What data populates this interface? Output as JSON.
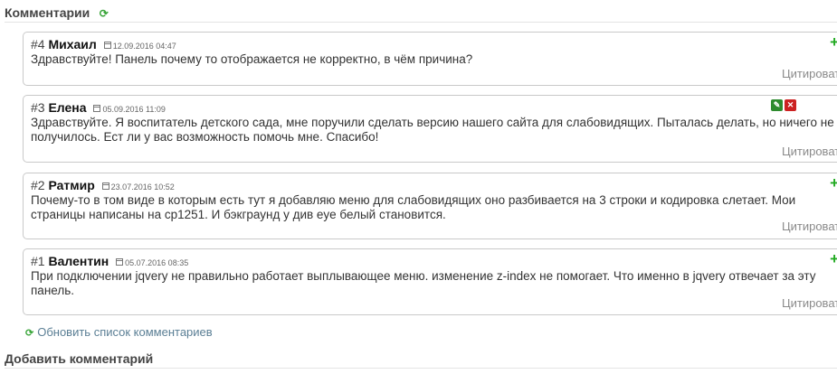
{
  "comments_section": {
    "title": "Комментарии",
    "refresh_icon": "refresh-icon"
  },
  "comments": [
    {
      "number": "#4",
      "author": "Михаил",
      "date": "12.09.2016 04:47",
      "text": "Здравствуйте! Панель почему то отображается не корректно, в чём причина?",
      "quote_label": "Цитировать",
      "add_label": "+"
    },
    {
      "number": "#3",
      "author": "Елена",
      "date": "05.09.2016 11:09",
      "text": "Здравствуйте. Я воспитатель детского сада, мне поручили сделать версию нашего сайта для слабовидящих. Пыталась делать, но ничего не получилось. Ест ли у вас возможность помочь мне. Спасибо!",
      "quote_label": "Цитировать",
      "add_label": ""
    },
    {
      "number": "#2",
      "author": "Ратмир",
      "date": "23.07.2016 10:52",
      "text": "Почему-то в том виде в которым есть тут я добавляю меню для слабовидящих оно разбивается на 3 строки и кодировка слетает. Мои страницы написаны на cp1251. И бэкграунд у див eye белый становится.",
      "quote_label": "Цитировать",
      "add_label": "+"
    },
    {
      "number": "#1",
      "author": "Валентин",
      "date": "05.07.2016 08:35",
      "text": "При подключении jqvery не правильно работает выплывающее меню. изменение z-index не помогает. Что именно в jqvery отвечает за эту панель.",
      "quote_label": "Цитировать",
      "add_label": "+"
    }
  ],
  "refresh_link": {
    "label": "Обновить список комментариев",
    "icon": "refresh-icon"
  },
  "add_comment_section": {
    "title": "Добавить комментарий"
  },
  "colors": {
    "accent_green": "#22aa22",
    "link": "#5b7f95",
    "border": "#c9c9c9",
    "muted": "#8a8a8a"
  }
}
